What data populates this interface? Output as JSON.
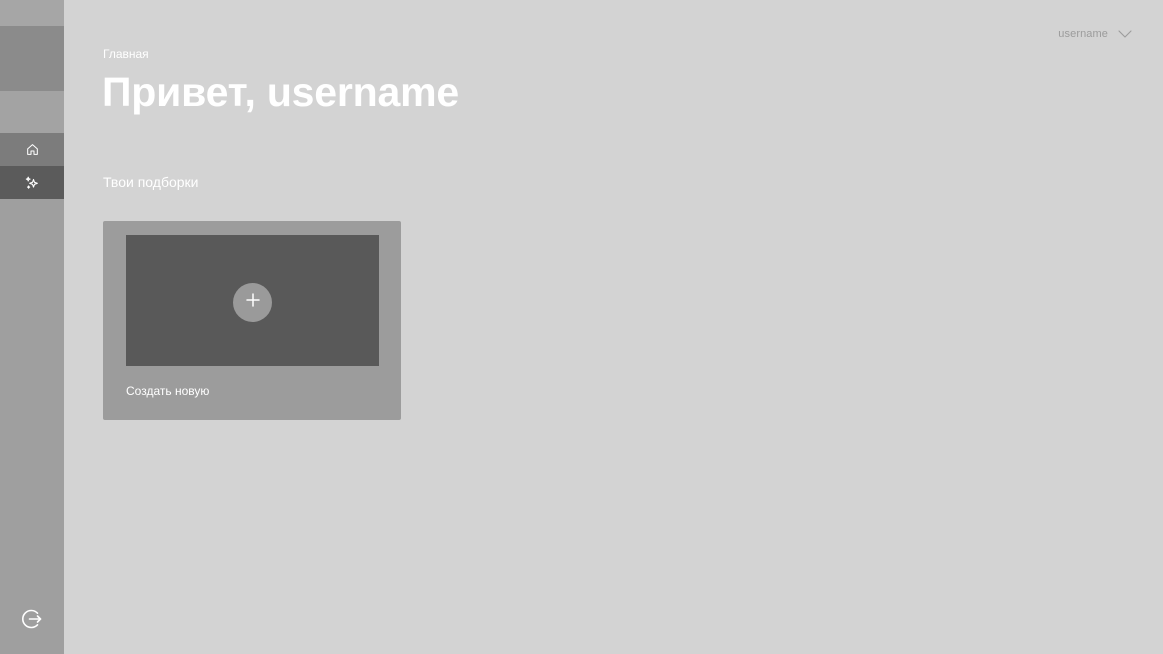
{
  "user": {
    "name": "username"
  },
  "breadcrumb": "Главная",
  "page_title": "Привет, username",
  "collections": {
    "section_title": "Твои подборки",
    "create_card_label": "Создать новую"
  },
  "sidebar": {
    "items": [
      {
        "icon": "home-icon",
        "active": false
      },
      {
        "icon": "sparkles-icon",
        "active": true
      }
    ],
    "logout_icon": "logout-icon"
  },
  "colors": {
    "background": "#d3d3d3",
    "sidebar": "#9f9f9f",
    "card": "#9c9c9c",
    "card_thumb": "#595959",
    "text": "#ffffff"
  }
}
